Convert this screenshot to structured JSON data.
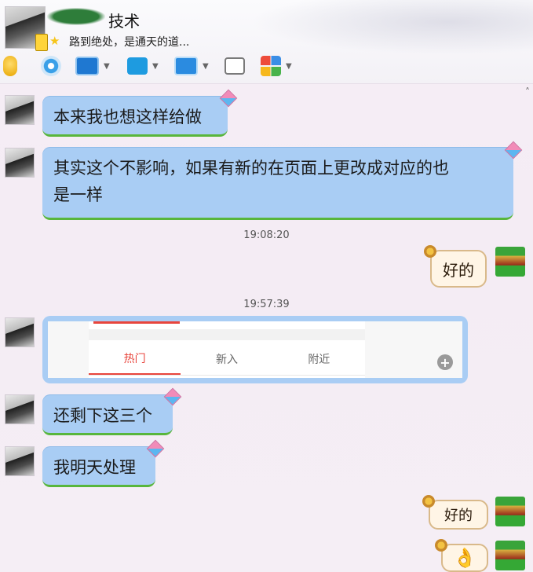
{
  "window": {
    "contact_name": "技术",
    "signature": "路到绝处，是通天的道..."
  },
  "toolbar": {
    "items": [
      {
        "icon": "microphone-icon"
      },
      {
        "icon": "video-call-icon"
      },
      {
        "icon": "screen-share-icon"
      },
      {
        "icon": "file-transfer-icon"
      },
      {
        "icon": "remote-desktop-icon"
      },
      {
        "icon": "new-message-icon"
      },
      {
        "icon": "apps-grid-icon"
      }
    ],
    "dropdown_glyph": "▼"
  },
  "scroll_arrow": "˄",
  "messages": {
    "m1": "本来我也想这样给做",
    "m2_line1": "其实这个不影响，如果有新的在页面上更改成对应的也",
    "m2_line2": "是一样",
    "t1": "19:08:20",
    "m3": "好的",
    "t2": "19:57:39",
    "image": {
      "tabs": [
        "热门",
        "新入",
        "附近"
      ],
      "zoom_glyph": "+"
    },
    "m4": "还剩下这三个",
    "m5": "我明天处理",
    "m6": "好的",
    "m7_emoji": "👌"
  },
  "colors": {
    "incoming_bubble": "#a9cdf4",
    "incoming_border": "#58b63c",
    "outgoing_bubble": "#fff5e6",
    "image_active_tab": "#e8453c"
  }
}
